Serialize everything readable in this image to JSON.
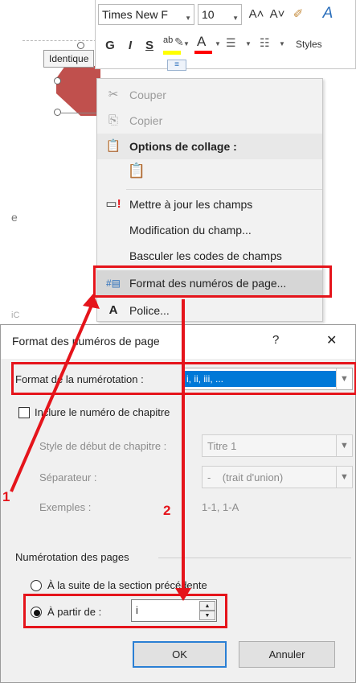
{
  "doc": {
    "tooltip": "Identique",
    "margin_mark": "e",
    "margin_mark_2": "iC"
  },
  "toolbar": {
    "font_name": "Times New F",
    "font_size": "10",
    "grow_font": "A˄",
    "shrink_font": "A˅",
    "bold": "G",
    "italic": "I",
    "underline": "S",
    "highlight": "ab",
    "font_color": "A",
    "styles_label": "Styles",
    "highlight_color": "#ffff00",
    "font_color_value": "#ff0000"
  },
  "menu": {
    "cut": "Couper",
    "copy": "Copier",
    "paste_options": "Options de collage :",
    "update_fields": "Mettre à jour les champs",
    "edit_field": "Modification du champ...",
    "toggle_codes": "Basculer les codes de champs",
    "page_number_format": "Format des numéros de page...",
    "font": "Police..."
  },
  "dialog": {
    "title": "Format des numéros de page",
    "help": "?",
    "close": "✕",
    "number_format_label": "Format de la numérotation :",
    "number_format_value": "i, ii, iii, ...",
    "include_chapter_label": "Inclure le numéro de chapitre",
    "chapter_style_label": "Style de début de chapitre :",
    "chapter_style_value": "Titre 1",
    "separator_label": "Séparateur :",
    "separator_value": "-    (trait d'union)",
    "examples_label": "Exemples :",
    "examples_value": "1-1, 1-A",
    "page_numbering_group": "Numérotation des pages",
    "continue_label": "À la suite de la section précédente",
    "start_at_label": "À partir de :",
    "start_at_value": "i",
    "ok": "OK",
    "cancel": "Annuler"
  },
  "annotations": {
    "step1": "1",
    "step2": "2",
    "highlight_color": "#e5141b"
  }
}
